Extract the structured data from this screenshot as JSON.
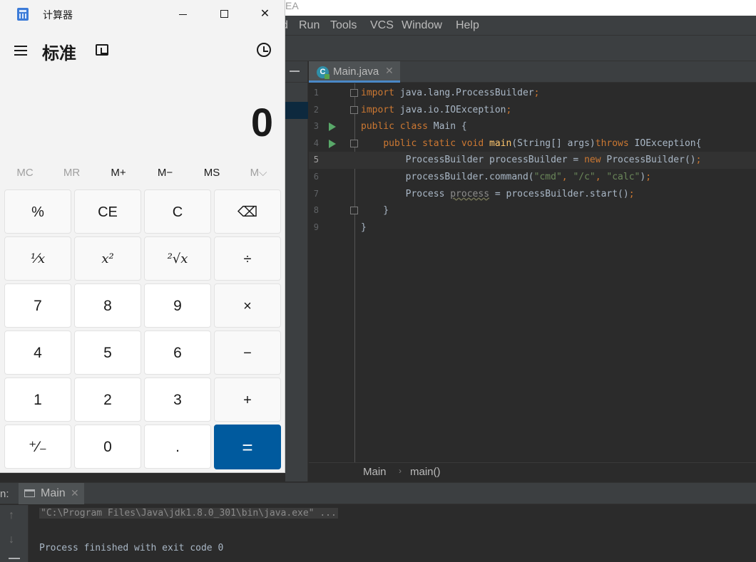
{
  "ide": {
    "title_fragment": "EA",
    "menu": [
      "d",
      "Run",
      "Tools",
      "VCS",
      "Window",
      "Help"
    ],
    "tab": {
      "label": "Main.java",
      "icon": "java-class-icon"
    },
    "code": [
      {
        "n": "1",
        "html": "<span class='kw'>import</span> java.lang.ProcessBuilder<span class='kw'>;</span>"
      },
      {
        "n": "2",
        "html": "<span class='kw'>import</span> java.io.IOException<span class='kw'>;</span>"
      },
      {
        "n": "3",
        "html": "<span class='kw'>public class</span> Main {"
      },
      {
        "n": "4",
        "html": "    <span class='kw'>public static void</span> <span class='fn'>main</span>(String[] args)<span class='kw'>throws</span> IOException{"
      },
      {
        "n": "5",
        "html": "        ProcessBuilder processBuilder = <span class='kw'>new</span> ProcessBuilder()<span class='kw'>;</span>"
      },
      {
        "n": "6",
        "html": "        processBuilder.command(<span class='str'>\"cmd\"</span><span class='kw'>,</span> <span class='str'>\"/c\"</span><span class='kw'>,</span> <span class='str'>\"calc\"</span>)<span class='kw'>;</span>"
      },
      {
        "n": "7",
        "html": "        Process <span class='wavy'>process</span> = processBuilder.start()<span class='kw'>;</span>"
      },
      {
        "n": "8",
        "html": "    }"
      },
      {
        "n": "9",
        "html": "}"
      }
    ],
    "breadcrumb": [
      "Main",
      "main()"
    ],
    "run": {
      "prefix": "n:",
      "tab_label": "Main",
      "command": "\"C:\\Program Files\\Java\\jdk1.8.0_301\\bin\\java.exe\" ...",
      "exit_message": "Process finished with exit code 0"
    },
    "colors": {
      "accent": "#4a88c7",
      "run_green": "#59a869"
    }
  },
  "calculator": {
    "title": "计算器",
    "mode": "标准",
    "display": "0",
    "memory": [
      {
        "label": "MC",
        "enabled": false
      },
      {
        "label": "MR",
        "enabled": false
      },
      {
        "label": "M+",
        "enabled": true
      },
      {
        "label": "M−",
        "enabled": true
      },
      {
        "label": "MS",
        "enabled": true
      },
      {
        "label": "M⌵",
        "enabled": false
      }
    ],
    "keys": [
      [
        "%",
        "CE",
        "C",
        "⌫"
      ],
      [
        "¹⁄x",
        "x²",
        "²√x",
        "÷"
      ],
      [
        "7",
        "8",
        "9",
        "×"
      ],
      [
        "4",
        "5",
        "6",
        "−"
      ],
      [
        "1",
        "2",
        "3",
        "+"
      ],
      [
        "⁺⁄₋",
        "0",
        ".",
        "="
      ]
    ],
    "colors": {
      "equals": "#005a9e"
    }
  }
}
